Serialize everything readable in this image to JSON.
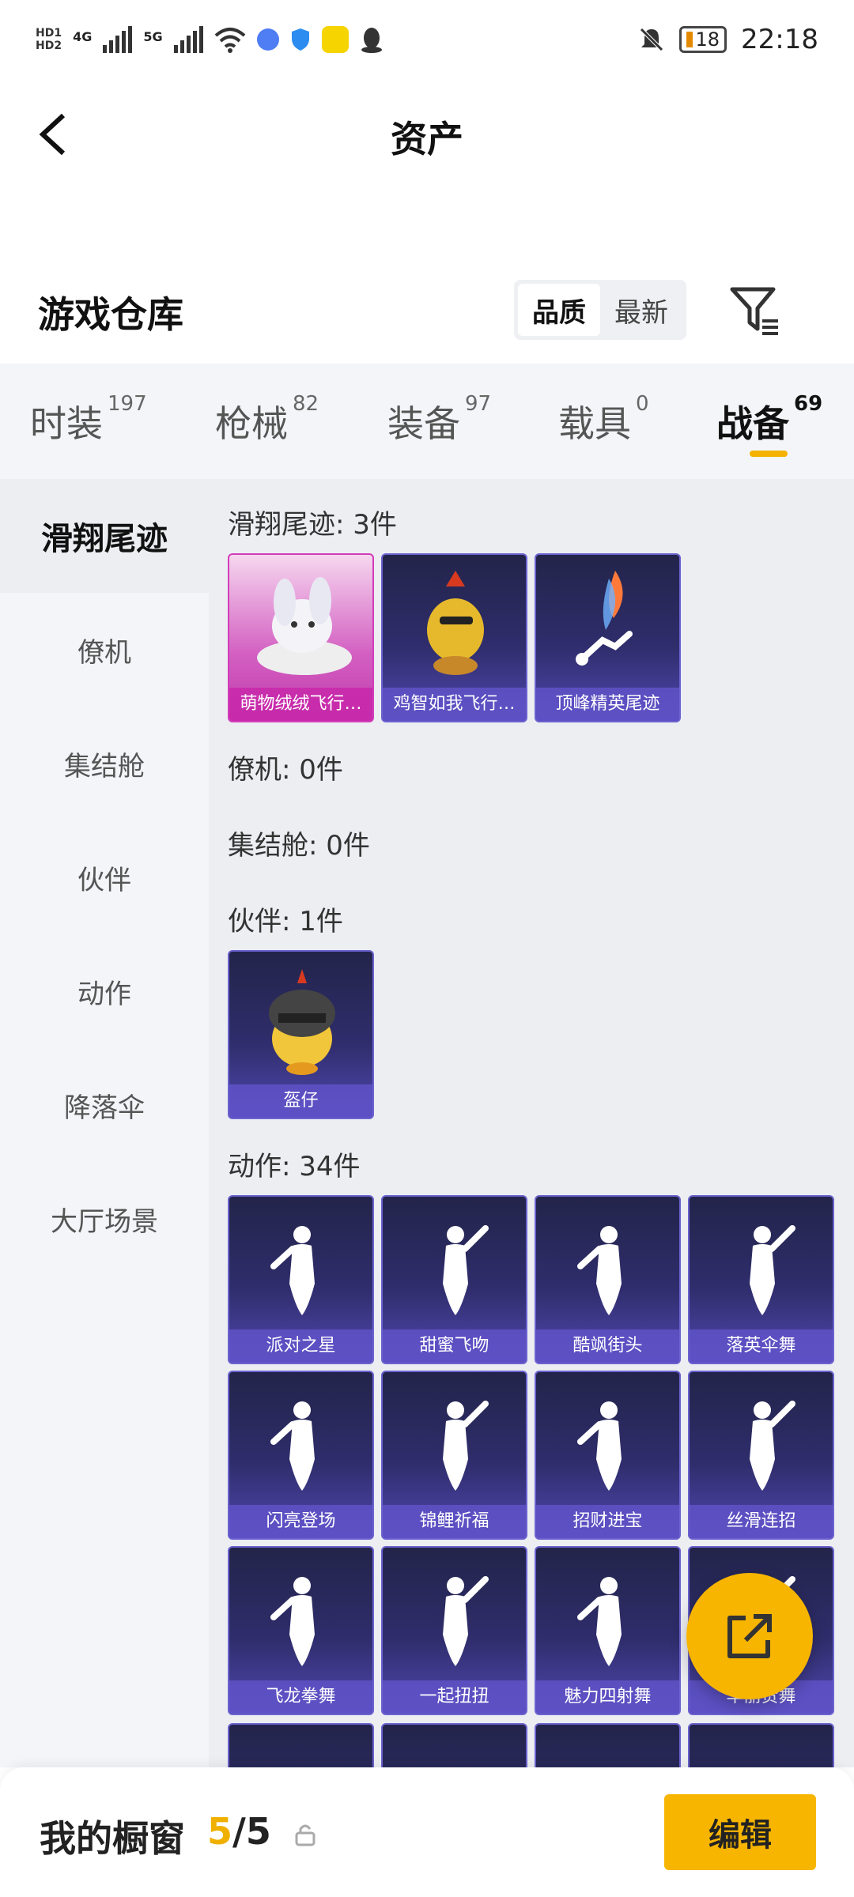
{
  "status_bar": {
    "network_left": "HD",
    "net_4g": "4G",
    "net_5g": "5G",
    "battery": "18",
    "time": "22:18"
  },
  "header": {
    "title": "资产",
    "back_icon": "chevron-left-icon"
  },
  "warehouse": {
    "title": "游戏仓库",
    "sort_options": [
      "品质",
      "最新"
    ],
    "sort_selected": "品质",
    "filter_icon": "filter-icon"
  },
  "category_tabs": [
    {
      "label": "时装",
      "count": "197"
    },
    {
      "label": "枪械",
      "count": "82"
    },
    {
      "label": "装备",
      "count": "97"
    },
    {
      "label": "载具",
      "count": "0"
    },
    {
      "label": "战备",
      "count": "69",
      "active": true
    }
  ],
  "sidebar": {
    "items": [
      "滑翔尾迹",
      "僚机",
      "集结舱",
      "伙伴",
      "动作",
      "降落伞",
      "大厅场景"
    ],
    "active": "滑翔尾迹"
  },
  "sections": {
    "glide_trail": {
      "title": "滑翔尾迹: 3件",
      "items": [
        "萌物绒绒飞行…",
        "鸡智如我飞行…",
        "顶峰精英尾迹"
      ]
    },
    "wingman": {
      "title": "僚机: 0件"
    },
    "assembly_pod": {
      "title": "集结舱: 0件"
    },
    "partner": {
      "title": "伙伴: 1件",
      "items": [
        "盔仔"
      ]
    },
    "emote": {
      "title": "动作: 34件",
      "items": [
        "派对之星",
        "甜蜜飞吻",
        "酷飒街头",
        "落英伞舞",
        "闪亮登场",
        "锦鲤祈福",
        "招财进宝",
        "丝滑连招",
        "飞龙拳舞",
        "一起扭扭",
        "魅力四射舞",
        "华丽贵舞"
      ]
    }
  },
  "bottom_bar": {
    "title": "我的橱窗",
    "count_current": "5",
    "count_sep": "/5",
    "edit_label": "编辑"
  },
  "colors": {
    "accent": "#f7b500",
    "card_purple": "#5148b0",
    "card_pink": "#d23db9"
  }
}
